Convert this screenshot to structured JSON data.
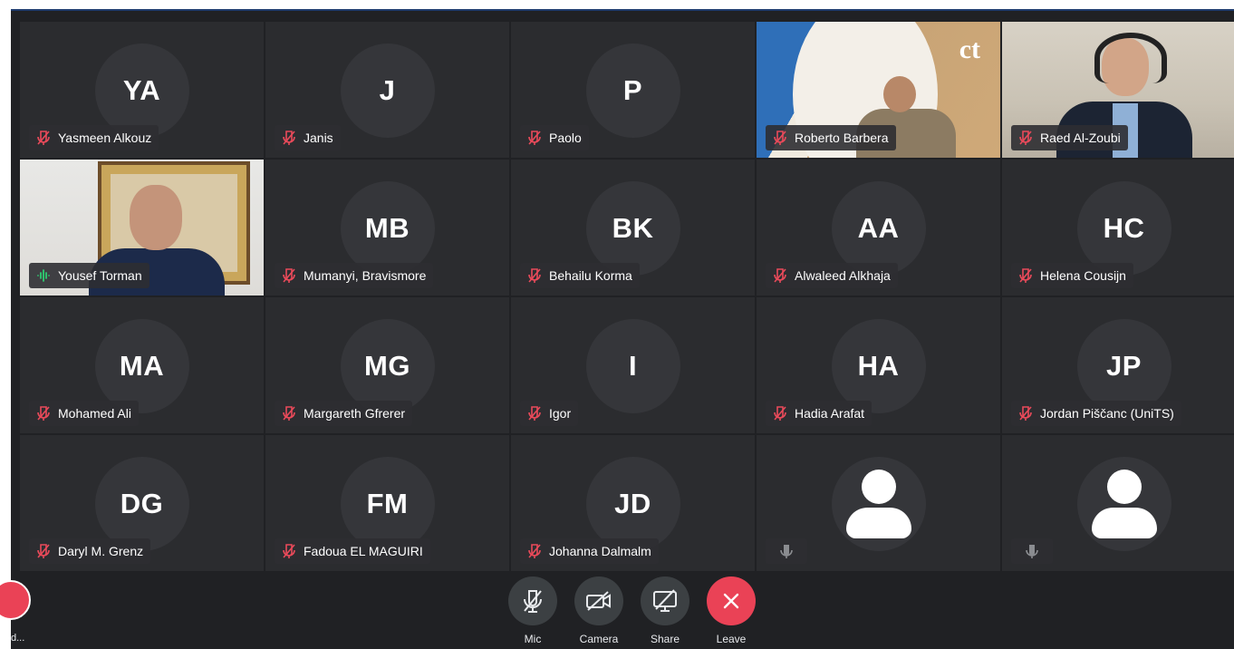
{
  "participants": [
    {
      "initials": "YA",
      "name": "Yasmeen Alkouz",
      "muted": true
    },
    {
      "initials": "J",
      "name": "Janis",
      "muted": true
    },
    {
      "initials": "P",
      "name": "Paolo",
      "muted": true
    },
    {
      "initials": "",
      "name": "Roberto Barbera",
      "muted": true,
      "video": true
    },
    {
      "initials": "",
      "name": "Raed Al-Zoubi",
      "muted": true,
      "video": true
    },
    {
      "initials": "",
      "name": "Yousef Torman",
      "muted": false,
      "speaking": true,
      "video": true
    },
    {
      "initials": "MB",
      "name": "Mumanyi, Bravismore",
      "muted": true
    },
    {
      "initials": "BK",
      "name": "Behailu Korma",
      "muted": true
    },
    {
      "initials": "AA",
      "name": "Alwaleed Alkhaja",
      "muted": true
    },
    {
      "initials": "HC",
      "name": "Helena Cousijn",
      "muted": true
    },
    {
      "initials": "MA",
      "name": "Mohamed Ali",
      "muted": true
    },
    {
      "initials": "MG",
      "name": "Margareth Gfrerer",
      "muted": true
    },
    {
      "initials": "I",
      "name": "Igor",
      "muted": true
    },
    {
      "initials": "HA",
      "name": "Hadia Arafat",
      "muted": true
    },
    {
      "initials": "JP",
      "name": "Jordan Piščanc (UniTS)",
      "muted": true
    },
    {
      "initials": "DG",
      "name": "Daryl M. Grenz",
      "muted": true
    },
    {
      "initials": "FM",
      "name": "Fadoua EL MAGUIRI",
      "muted": true
    },
    {
      "initials": "JD",
      "name": "Johanna Dalmalm",
      "muted": true
    },
    {
      "initials": "",
      "name": "",
      "muted": false,
      "no_avatar": true
    },
    {
      "initials": "",
      "name": "",
      "muted": false,
      "no_avatar": true
    }
  ],
  "roberto_logo": "ct",
  "controls": {
    "mic_label": "Mic",
    "camera_label": "Camera",
    "share_label": "Share",
    "leave_label": "Leave",
    "left_cut_label": "d..."
  },
  "colors": {
    "background": "#202124",
    "tile": "#2b2c2f",
    "muted_icon": "#e94a5a",
    "speaking_icon": "#2ecc71",
    "leave_button": "#ea4256"
  }
}
